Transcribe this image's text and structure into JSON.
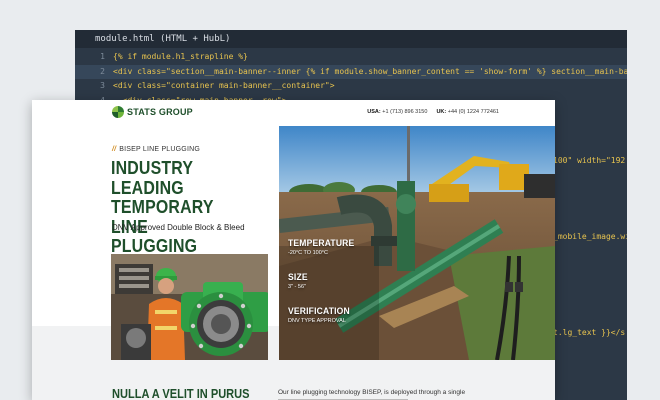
{
  "editor": {
    "tab_title": "module.html (HTML + HubL)",
    "lines": [
      {
        "num": "1",
        "code": "{% if module.h1_strapline %}"
      },
      {
        "num": "2",
        "code": "<div class=\"section__main-banner--inner {% if module.show_banner_content == 'show-form' %} section__main-banner--"
      },
      {
        "num": "3",
        "code": "<div class=\"container main-banner__container\">"
      },
      {
        "num": "4",
        "code": "  <div class=\"row main-banner__row\">"
      }
    ],
    "peek_fragments": [
      {
        "text": "100\" width=\"192"
      },
      {
        "text": "_mobile_image.wi"
      },
      {
        "text": "t.lg_text }}</s"
      }
    ]
  },
  "site": {
    "logo_text": "STATS GROUP",
    "phones": {
      "usa_label": "USA:",
      "usa_number": "+1 (713) 896 3150",
      "uk_label": "UK:",
      "uk_number": "+44 (0) 1224 772461"
    },
    "eyebrow_marks": "//",
    "eyebrow": "BISEP LINE PLUGGING",
    "title_lines": [
      "INDUSTRY LEADING",
      "TEMPORARY LINE",
      "PLUGGING"
    ],
    "subtitle": "DNV Approved Double Block & Bleed",
    "stats": [
      {
        "label": "TEMPERATURE",
        "value": "-20°C TO 100°C"
      },
      {
        "label": "SIZE",
        "value": "3\" - 56\""
      },
      {
        "label": "VERIFICATION",
        "value": "DNV TYPE APPROVAL"
      }
    ],
    "section_title": "NULLA A VELIT IN PURUS",
    "body_text": "Our line plugging technology BISEP, is deployed through a single"
  },
  "colors": {
    "brand_green": "#1f4f2b",
    "accent_orange": "#d08a1e",
    "editor_bg": "#2c3846",
    "code_yellow": "#e7c34f"
  }
}
